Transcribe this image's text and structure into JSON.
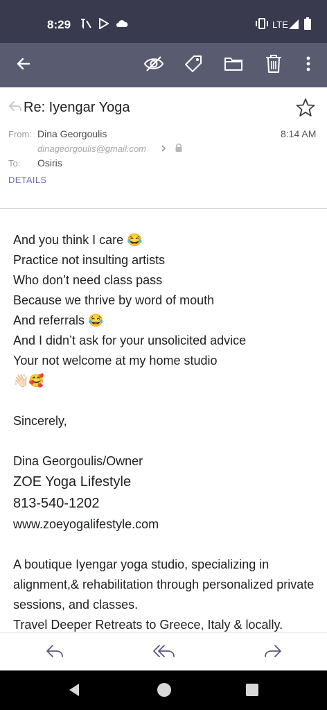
{
  "status_bar": {
    "time": "8:29",
    "network": "LTE"
  },
  "app_bar": {
    "icons": [
      "back-arrow-icon",
      "hide-icon",
      "label-icon",
      "folder-icon",
      "trash-icon",
      "more-vert-icon"
    ]
  },
  "header": {
    "subject": "Re: Iyengar Yoga",
    "from_label": "From:",
    "from_name": "Dina Georgoulis",
    "from_email": "dinageorgoulis@gmail.com",
    "to_label": "To:",
    "to_name": "Osiris",
    "time": "8:14 AM",
    "details_label": "DETAILS"
  },
  "body": {
    "lines": [
      "And you think I care 😂",
      "Practice not insulting artists",
      "Who don’t need class pass",
      "Because we thrive by word of mouth",
      "And referrals 😂",
      "And I didn’t ask for your unsolicited advice",
      "Your not welcome at my home studio",
      "👋🏻🥰"
    ],
    "sign_off": "Sincerely,",
    "signature_name": "Dina Georgoulis/Owner",
    "signature_company": "ZOE Yoga Lifestyle",
    "signature_phone": "813-540-1202",
    "signature_url": "www.zoeyogalifestyle.com",
    "description": "A boutique Iyengar yoga studio, specializing in alignment,& rehabilitation through personalized private sessions, and classes.",
    "retreats": "Travel Deeper Retreats to Greece, Italy & locally."
  },
  "colors": {
    "status_bar": "#393a4e",
    "app_bar": "#595b70",
    "accent": "#6a6fb0"
  }
}
